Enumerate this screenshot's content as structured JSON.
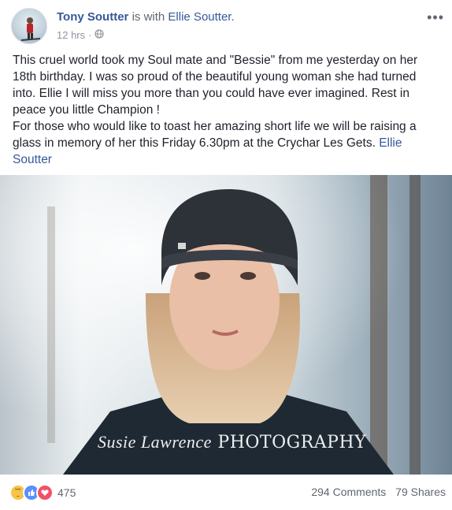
{
  "post": {
    "author": "Tony Soutter",
    "with_text": "is with",
    "tagged_person": "Ellie Soutter.",
    "time": "12 hrs",
    "privacy_icon": "globe-icon",
    "more_icon": "ellipsis-icon",
    "text_line1": "This cruel world took my Soul mate and \"Bessie\" from me yesterday on her 18th birthday. I was so proud of the beautiful young woman she had turned into. Ellie I will miss you more than you could have ever imagined. Rest in peace you little Champion !",
    "text_line2": "For those who would like to toast her amazing short life we will be raising a glass in memory of her this Friday 6.30pm at the Crychar Les Gets.",
    "mention": "Ellie Soutter",
    "photo_watermark_script": "Susie Lawrence",
    "photo_watermark_caps": "PHOTOGRAPHY"
  },
  "footer": {
    "reaction_icons": [
      "sad-icon",
      "like-icon",
      "love-icon"
    ],
    "reaction_count": "475",
    "comments": "294 Comments",
    "shares": "79 Shares"
  }
}
